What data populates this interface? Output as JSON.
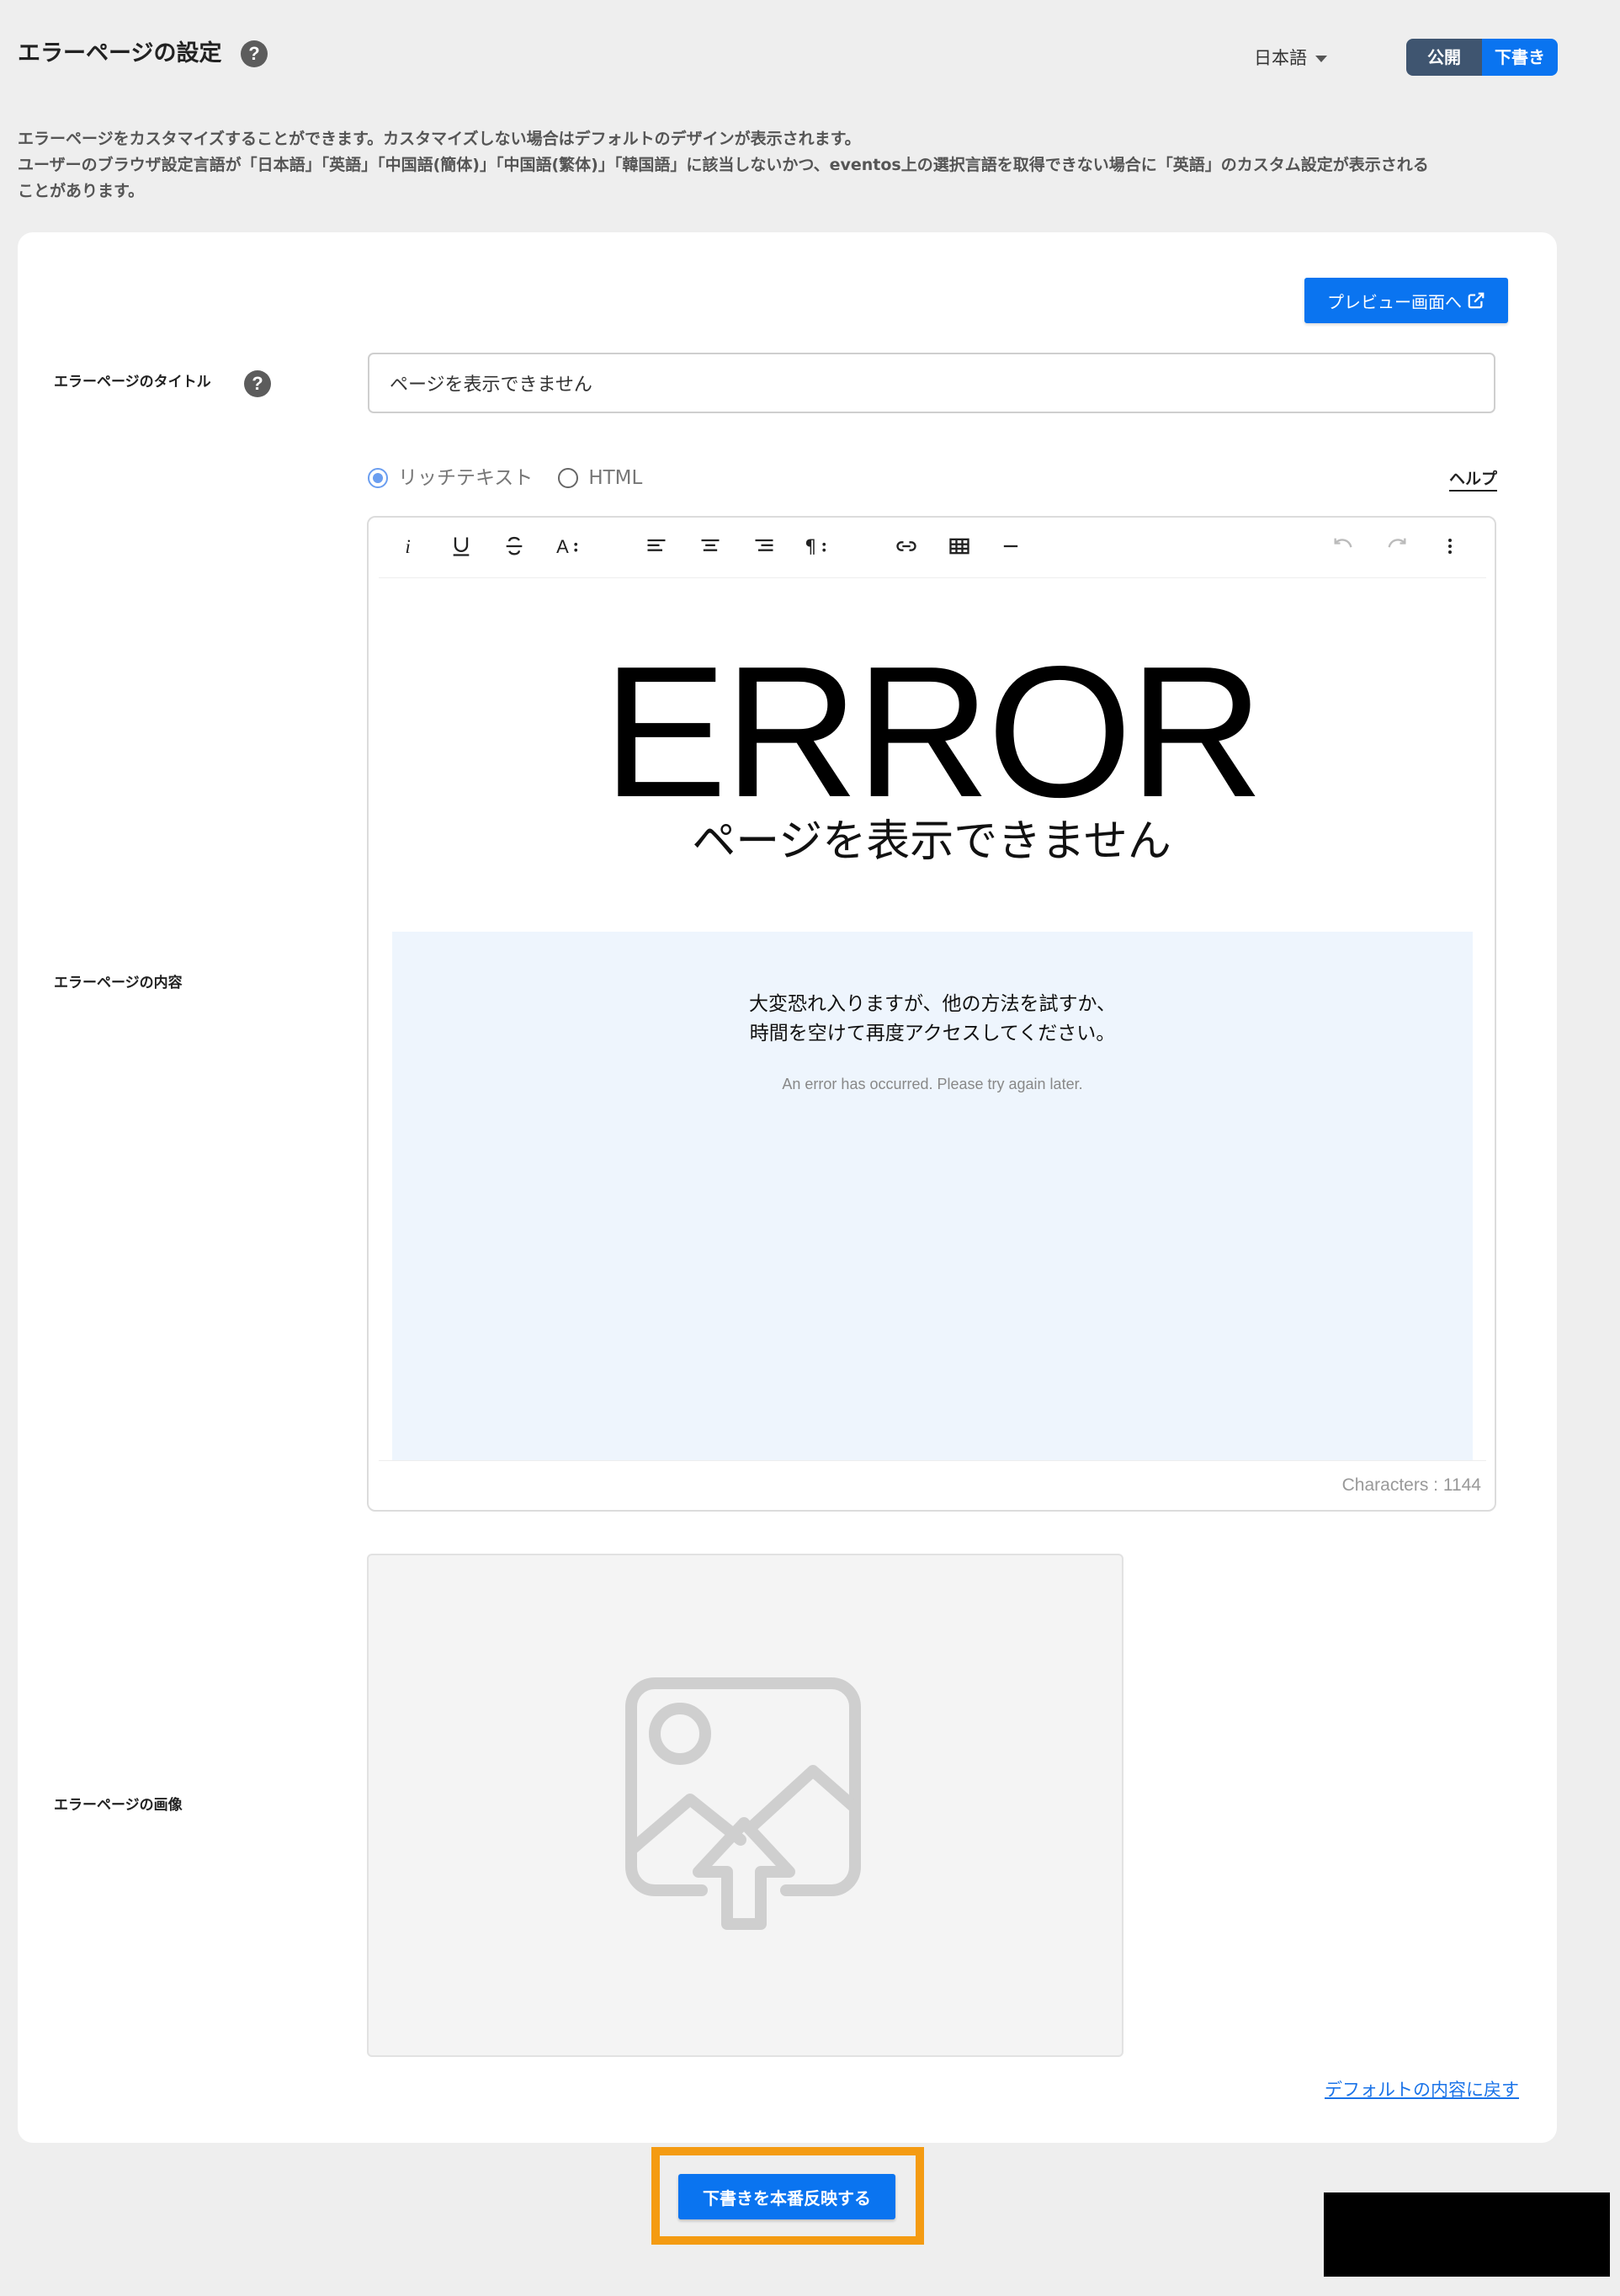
{
  "header": {
    "title": "エラーページの設定",
    "help_icon": "?",
    "language": "日本語",
    "toggle": {
      "publish": "公開",
      "draft": "下書き"
    }
  },
  "description": [
    "エラーページをカスタマイズすることができます。カスタマイズしない場合はデフォルトのデザインが表示されます。",
    "ユーザーのブラウザ設定言語が「日本語」「英語」「中国語(簡体)」「中国語(繁体)」「韓国語」に該当しないかつ、eventos上の選択言語を取得できない場合に「英語」のカスタム設定が表示される",
    "ことがあります。"
  ],
  "card": {
    "preview_button": "プレビュー画面へ",
    "title_field": {
      "label": "エラーページのタイトル",
      "value": "ページを表示できません"
    },
    "content_field": {
      "label": "エラーページの内容",
      "mode_rich": "リッチテキスト",
      "mode_html": "HTML",
      "selected_mode": "リッチテキスト",
      "help_link": "ヘルプ",
      "toolbar": [
        "italic-icon",
        "underline-icon",
        "strikethrough-icon",
        "font-size-icon",
        "align-left-icon",
        "align-center-icon",
        "align-right-icon",
        "paragraph-icon",
        "link-icon",
        "table-icon",
        "horizontal-rule-icon",
        "undo-icon",
        "redo-icon",
        "more-icon"
      ],
      "body": {
        "heading": "ERROR",
        "subheading": "ページを表示できません",
        "message_line1": "大変恐れ入りますが、他の方法を試すか、",
        "message_line2": "時間を空けて再度アクセスしてください。",
        "message_en": "An error has occurred. Please try again later."
      },
      "char_count": "Characters : 1144"
    },
    "image_field": {
      "label": "エラーページの画像",
      "placeholder_icon": "image-upload-icon"
    },
    "reset_link": "デフォルトの内容に戻す"
  },
  "publish_button": "下書きを本番反映する",
  "colors": {
    "primary": "#0a74f0",
    "toggle_publish": "#3f5570",
    "highlight": "#f49b12",
    "content_bg": "#eef5fd"
  }
}
